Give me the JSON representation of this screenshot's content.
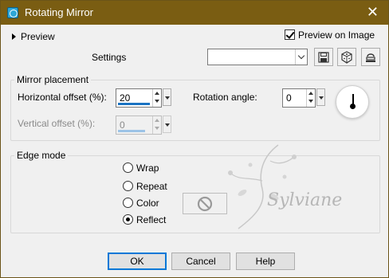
{
  "window": {
    "title": "Rotating Mirror"
  },
  "preview": {
    "label": "Preview",
    "preview_on_image_label": "Preview on Image",
    "preview_on_image_checked": true
  },
  "settings": {
    "label": "Settings",
    "value": ""
  },
  "mirror_placement": {
    "group_label": "Mirror placement",
    "horizontal_offset_label": "Horizontal offset (%):",
    "horizontal_offset_value": "20",
    "vertical_offset_label": "Vertical offset (%):",
    "vertical_offset_value": "0",
    "rotation_angle_label": "Rotation angle:",
    "rotation_angle_value": "0"
  },
  "edge_mode": {
    "group_label": "Edge mode",
    "options": [
      "Wrap",
      "Repeat",
      "Color",
      "Reflect"
    ],
    "selected": "Reflect"
  },
  "buttons": {
    "ok": "OK",
    "cancel": "Cancel",
    "help": "Help"
  },
  "watermark": {
    "text": "Sylviane"
  },
  "colors": {
    "titlebar": "#7a5d12",
    "accent": "#0078d7"
  }
}
